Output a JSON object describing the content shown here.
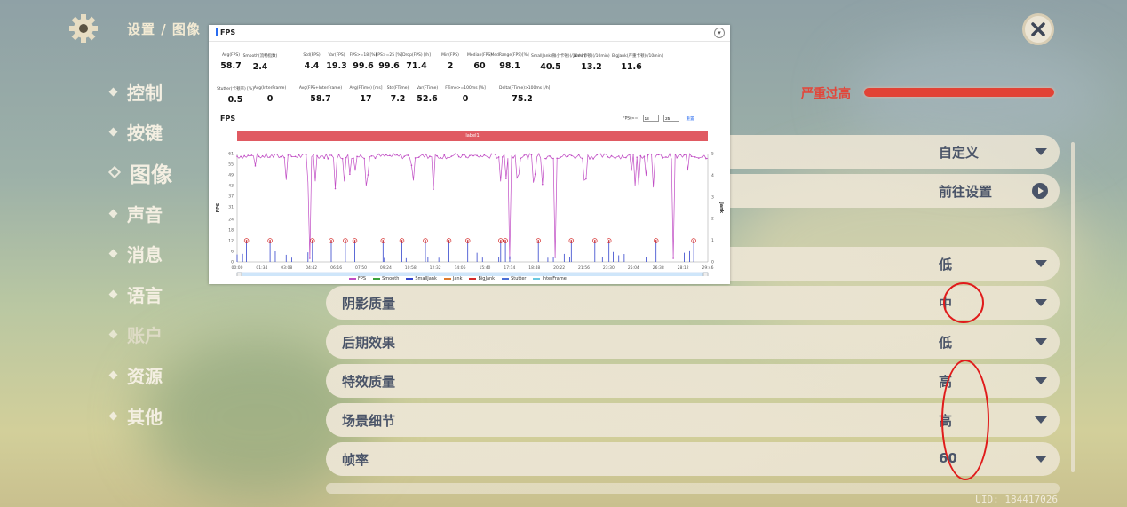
{
  "header": {
    "title": "设置 / 图像"
  },
  "sidebar": {
    "items": [
      {
        "label": "控制"
      },
      {
        "label": "按键"
      },
      {
        "label": "图像"
      },
      {
        "label": "声音"
      },
      {
        "label": "消息"
      },
      {
        "label": "语言"
      },
      {
        "label": "账户"
      },
      {
        "label": "资源"
      },
      {
        "label": "其他"
      }
    ]
  },
  "warning": {
    "label": "严重过高"
  },
  "settings": {
    "rows": [
      {
        "label": "",
        "value": "自定义"
      },
      {
        "label": "",
        "value": "前往设置"
      },
      {
        "label": "",
        "value": "低"
      },
      {
        "label": "阴影质量",
        "value": "中"
      },
      {
        "label": "后期效果",
        "value": "低"
      },
      {
        "label": "特效质量",
        "value": "高"
      },
      {
        "label": "场景细节",
        "value": "高"
      },
      {
        "label": "帧率",
        "value": "60"
      }
    ]
  },
  "uid": "UID: 184417026",
  "fps_panel": {
    "title": "FPS",
    "stats_row1": [
      {
        "h": "Avg(FPS)",
        "v": "58.7"
      },
      {
        "h": "Smooth(流畅指数)",
        "v": "2.4"
      },
      {
        "h": "Std(FPS)",
        "v": "4.4"
      },
      {
        "h": "Var(FPS)",
        "v": "19.3"
      },
      {
        "h": "FPS>=18 [%]",
        "v": "99.6"
      },
      {
        "h": "FPS>=25 [%]",
        "v": "99.6"
      },
      {
        "h": "Drop(FPS) [/h]",
        "v": "71.4"
      },
      {
        "h": "Min(FPS)",
        "v": "2"
      },
      {
        "h": "Median(FPS)",
        "v": "60"
      },
      {
        "h": "MedRange(FPS)[%]",
        "v": "98.1"
      },
      {
        "h": "SmallJank(微小卡顿)(/10min)",
        "v": "40.5"
      },
      {
        "h": "Jank(卡顿)(/10min)",
        "v": "13.2"
      },
      {
        "h": "BigJank(严重卡顿)(/10min)",
        "v": "11.6"
      }
    ],
    "stats_row2": [
      {
        "h": "Stutter(卡顿率) [%]",
        "v": "0.5"
      },
      {
        "h": "Avg(InterFrame)",
        "v": "0"
      },
      {
        "h": "Avg(FPS+InterFrame)",
        "v": "58.7"
      },
      {
        "h": "Avg(FTime) [ms]",
        "v": "17"
      },
      {
        "h": "Std(FTime)",
        "v": "7.2"
      },
      {
        "h": "Var(FTime)",
        "v": "52.6"
      },
      {
        "h": "FTime>=100ms [%]",
        "v": "0"
      },
      {
        "h": "Delta(FTime)>100ms [/h]",
        "v": "75.2"
      }
    ],
    "chart_title": "FPS",
    "fps_filter_label": "FPS(>=)",
    "fps_filter_a": "18",
    "fps_filter_b": "25",
    "reset_label": "重置",
    "label_bar": "label1",
    "legend": [
      {
        "name": "FPS",
        "color": "#c04cc4"
      },
      {
        "name": "Smooth",
        "color": "#3aa33a"
      },
      {
        "name": "SmallJank",
        "color": "#3344cc"
      },
      {
        "name": "Jank",
        "color": "#e07a2a"
      },
      {
        "name": "BigJank",
        "color": "#d42a2a"
      },
      {
        "name": "Stutter",
        "color": "#4b6fd6"
      },
      {
        "name": "InterFrame",
        "color": "#69c8e0"
      }
    ]
  },
  "chart_data": {
    "type": "line",
    "title": "FPS",
    "xlabel": "",
    "ylabel": "FPS",
    "y2label": "Jank",
    "yticks": [
      0,
      6,
      12,
      18,
      24,
      31,
      37,
      43,
      49,
      55,
      61
    ],
    "y2ticks": [
      0,
      1,
      2,
      3,
      4,
      5
    ],
    "xticks": [
      "00:00",
      "01:34",
      "03:08",
      "04:42",
      "06:16",
      "07:50",
      "09:24",
      "10:58",
      "12:32",
      "14:06",
      "15:40",
      "17:14",
      "18:48",
      "20:22",
      "21:56",
      "23:30",
      "25:04",
      "26:38",
      "28:12",
      "29:46"
    ],
    "series": [
      {
        "name": "FPS",
        "approx": "mostly 58-61 with dips"
      },
      {
        "name": "BigJank",
        "approx": "markers at ~12 FPS level"
      }
    ],
    "ylim": [
      0,
      61
    ],
    "y2lim": [
      0,
      5
    ]
  }
}
